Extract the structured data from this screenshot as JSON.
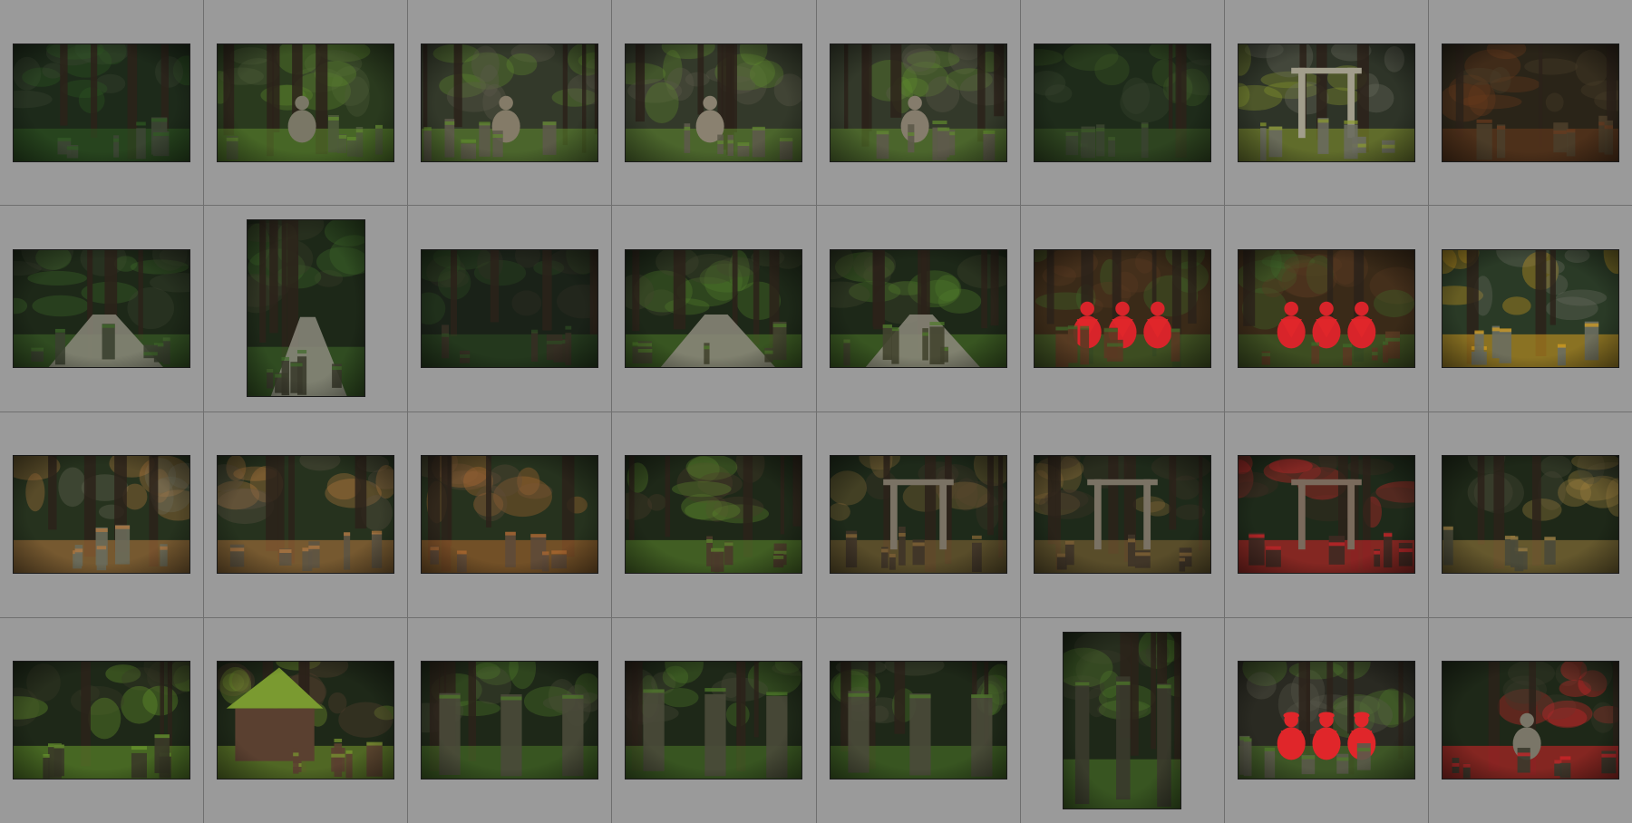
{
  "grid": {
    "columns": 8,
    "rows": 4,
    "thumbnails": [
      {
        "subject": "stone-grave-markers",
        "orientation": "landscape",
        "palette": [
          "#1d2a1a",
          "#3d4634",
          "#6b6a5c",
          "#2f5a22"
        ]
      },
      {
        "subject": "seated-stone-statue",
        "orientation": "landscape",
        "palette": [
          "#2a3a1e",
          "#4e5b3a",
          "#7a7766",
          "#5f8a2e"
        ]
      },
      {
        "subject": "seated-stone-statue",
        "orientation": "landscape",
        "palette": [
          "#33392a",
          "#5d5a4a",
          "#847b68",
          "#5f8a2e"
        ]
      },
      {
        "subject": "seated-stone-statue",
        "orientation": "landscape",
        "palette": [
          "#33392a",
          "#5d5a4a",
          "#8a8170",
          "#5f8a2e"
        ]
      },
      {
        "subject": "seated-stone-statue",
        "orientation": "landscape",
        "palette": [
          "#33392a",
          "#5d5a4a",
          "#857c6c",
          "#5f8a2e"
        ]
      },
      {
        "subject": "monuments-behind-fence",
        "orientation": "landscape",
        "palette": [
          "#1e2b1a",
          "#3a4430",
          "#6e6d60",
          "#3c5a26"
        ]
      },
      {
        "subject": "torii-gate-steps",
        "orientation": "landscape",
        "palette": [
          "#2e3428",
          "#6a6c5e",
          "#a29e8c",
          "#8a9a2e"
        ]
      },
      {
        "subject": "forest-gravestones",
        "orientation": "landscape",
        "palette": [
          "#2a2418",
          "#4b3e2a",
          "#7a6c54",
          "#6a3a1e"
        ]
      },
      {
        "subject": "stone-forest-path",
        "orientation": "landscape",
        "palette": [
          "#1d2818",
          "#3b4130",
          "#8a877a",
          "#3f6a2a"
        ]
      },
      {
        "subject": "stone-forest-path",
        "orientation": "portrait",
        "palette": [
          "#1d2818",
          "#3b3b2c",
          "#8c8a7e",
          "#3f6a2a"
        ]
      },
      {
        "subject": "forest-gravestones",
        "orientation": "landscape",
        "palette": [
          "#1a2218",
          "#352f24",
          "#7b786c",
          "#2e4a22"
        ]
      },
      {
        "subject": "stone-forest-path",
        "orientation": "landscape",
        "palette": [
          "#1d2818",
          "#43442f",
          "#8d8a7c",
          "#4f7a2a"
        ]
      },
      {
        "subject": "stone-forest-path",
        "orientation": "landscape",
        "palette": [
          "#1d2818",
          "#43442f",
          "#8d8a7c",
          "#4f7a2a"
        ]
      },
      {
        "subject": "jizo-red-bibs",
        "orientation": "landscape",
        "palette": [
          "#3a2a18",
          "#5a3a22",
          "#d8242a",
          "#3f6a2a"
        ]
      },
      {
        "subject": "jizo-red-bibs",
        "orientation": "landscape",
        "palette": [
          "#3a2a18",
          "#5a3a22",
          "#d8242a",
          "#3f6a2a"
        ]
      },
      {
        "subject": "forest-gravestones",
        "orientation": "landscape",
        "palette": [
          "#2a3a26",
          "#6a6e60",
          "#b8b4a4",
          "#d8a020"
        ]
      },
      {
        "subject": "cemetery-plot",
        "orientation": "landscape",
        "palette": [
          "#26321e",
          "#6a6a5a",
          "#b4b0a0",
          "#b87a40"
        ]
      },
      {
        "subject": "cemetery-plot",
        "orientation": "landscape",
        "palette": [
          "#26321e",
          "#5e5444",
          "#a09a8a",
          "#b87a40"
        ]
      },
      {
        "subject": "cemetery-plot",
        "orientation": "landscape",
        "palette": [
          "#26321e",
          "#5e4a3a",
          "#9a8a78",
          "#b06a30"
        ]
      },
      {
        "subject": "mossy-cemetery",
        "orientation": "landscape",
        "palette": [
          "#1e2818",
          "#4a3a2a",
          "#7a6a58",
          "#5f8a2e"
        ]
      },
      {
        "subject": "pagoda-gate",
        "orientation": "landscape",
        "palette": [
          "#1e2a1a",
          "#3e3428",
          "#7a7264",
          "#8a6a38"
        ]
      },
      {
        "subject": "pagoda-gate",
        "orientation": "landscape",
        "palette": [
          "#1e2a1a",
          "#3e3428",
          "#7a7264",
          "#8a6a38"
        ]
      },
      {
        "subject": "pagoda-gate",
        "orientation": "landscape",
        "palette": [
          "#1e2a1a",
          "#3e2a22",
          "#7a6a5c",
          "#d8242a"
        ]
      },
      {
        "subject": "forest-gravestones",
        "orientation": "landscape",
        "palette": [
          "#1e2818",
          "#4a4a3a",
          "#9a9684",
          "#a08040"
        ]
      },
      {
        "subject": "mossy-cemetery",
        "orientation": "landscape",
        "palette": [
          "#1e2818",
          "#3a3a28",
          "#6e6a58",
          "#6a9a2e"
        ]
      },
      {
        "subject": "moss-roof-shrine",
        "orientation": "landscape",
        "palette": [
          "#1e2818",
          "#5a4030",
          "#8a8470",
          "#7a9a30"
        ]
      },
      {
        "subject": "stone-pillars-forest",
        "orientation": "landscape",
        "palette": [
          "#1e2818",
          "#4a4a3a",
          "#8a8474",
          "#4f7a2a"
        ]
      },
      {
        "subject": "stone-pillars-forest",
        "orientation": "landscape",
        "palette": [
          "#1e2818",
          "#4a4a3a",
          "#8a8474",
          "#4f7a2a"
        ]
      },
      {
        "subject": "stone-pillars-forest",
        "orientation": "landscape",
        "palette": [
          "#1e2818",
          "#4a4a3a",
          "#8a8474",
          "#4f7a2a"
        ]
      },
      {
        "subject": "stone-pillars-forest",
        "orientation": "portrait",
        "palette": [
          "#1e2818",
          "#3a3a2c",
          "#7a7668",
          "#4f7a2a"
        ]
      },
      {
        "subject": "jizo-red-hats",
        "orientation": "landscape",
        "palette": [
          "#2a2a22",
          "#5a5a4a",
          "#e0262a",
          "#4f7a2a"
        ]
      },
      {
        "subject": "seated-statue-cemetery",
        "orientation": "landscape",
        "palette": [
          "#1e2818",
          "#3a3a2c",
          "#7a7668",
          "#d8242a"
        ]
      }
    ]
  }
}
